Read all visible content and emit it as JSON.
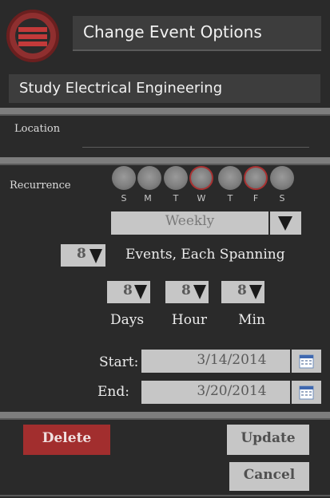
{
  "header": {
    "title": "Change Event Options",
    "menu_icon": "hamburger-menu-icon"
  },
  "event": {
    "name": "Study Electrical Engineering"
  },
  "location": {
    "label": "Location",
    "value": ""
  },
  "recurrence": {
    "label": "Recurrence",
    "days": [
      {
        "letter": "S",
        "selected": false
      },
      {
        "letter": "M",
        "selected": false
      },
      {
        "letter": "T",
        "selected": false
      },
      {
        "letter": "W",
        "selected": true
      },
      {
        "letter": "T",
        "selected": false
      },
      {
        "letter": "F",
        "selected": true
      },
      {
        "letter": "S",
        "selected": false
      }
    ],
    "frequency": "Weekly",
    "count": "8",
    "events_label": "Events, Each Spanning",
    "span": {
      "days_value": "8",
      "days_label": "Days",
      "hour_value": "8",
      "hour_label": "Hour",
      "min_value": "8",
      "min_label": "Min"
    }
  },
  "dates": {
    "start_label": "Start:",
    "start_value": "3/14/2014",
    "end_label": "End:",
    "end_value": "3/20/2014",
    "calendar_icon": "calendar-icon"
  },
  "actions": {
    "delete_label": "Delete",
    "update_label": "Update",
    "cancel_label": "Cancel"
  },
  "colors": {
    "accent_red": "#a22e2e",
    "field_gray": "#c6c6c6",
    "background": "#2a2a2a"
  }
}
